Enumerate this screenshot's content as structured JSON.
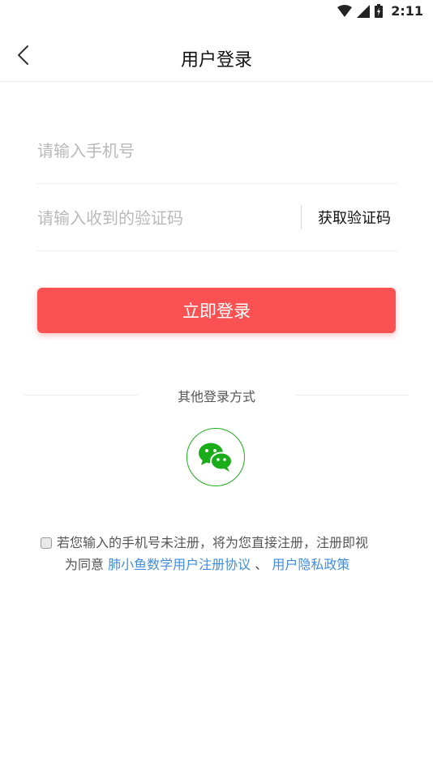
{
  "status_bar": {
    "time": "2:11"
  },
  "header": {
    "title": "用户登录"
  },
  "form": {
    "phone_placeholder": "请输入手机号",
    "code_placeholder": "请输入收到的验证码",
    "get_code_label": "获取验证码",
    "login_label": "立即登录"
  },
  "other_login": {
    "label": "其他登录方式"
  },
  "agreement": {
    "text_part1": "若您输入的手机号未注册，将为您直接注册，注册即视",
    "text_part2": "为同意",
    "user_agreement_link": "肺小鱼数学用户注册协议",
    "separator": "、",
    "privacy_link": "用户隐私政策"
  },
  "colors": {
    "primary": "#fa5252",
    "link": "#3f8ee0",
    "wechat": "#1aad19"
  }
}
